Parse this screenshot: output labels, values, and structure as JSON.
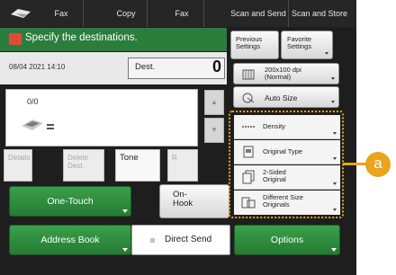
{
  "tabs": [
    {
      "label": "Fax"
    },
    {
      "label": "Copy"
    },
    {
      "label": "Fax"
    },
    {
      "label": "Scan and Send"
    },
    {
      "label": "Scan and Store"
    }
  ],
  "header": {
    "title": "Specify the destinations."
  },
  "top_buttons": {
    "previous_settings": "Previous Settings",
    "favorite_settings": "Favorite Settings"
  },
  "status": {
    "datetime": "08/04 2021 14:10",
    "dest_label": "Dest.",
    "dest_count": "0"
  },
  "list": {
    "counter": "0/0"
  },
  "small_buttons": {
    "details": "Details",
    "delete_dest": "Delete Dest.",
    "tone": "Tone",
    "r": "R"
  },
  "actions": {
    "one_touch": "One-Touch",
    "on_hook": "On-Hook",
    "address_book": "Address Book",
    "direct_send": "Direct Send",
    "options": "Options"
  },
  "settings": {
    "resolution": "200x100 dpi (Normal)",
    "auto_size": "Auto Size"
  },
  "option_list": {
    "density": "Density",
    "original_type": "Original Type",
    "two_sided": "2-Sided Original",
    "different_size": "Different Size Originals"
  },
  "callout": {
    "label": "a",
    "color": "#e8a51d"
  },
  "colors": {
    "header_green": "#2b7d3b",
    "button_green": "#2e8b3e"
  }
}
